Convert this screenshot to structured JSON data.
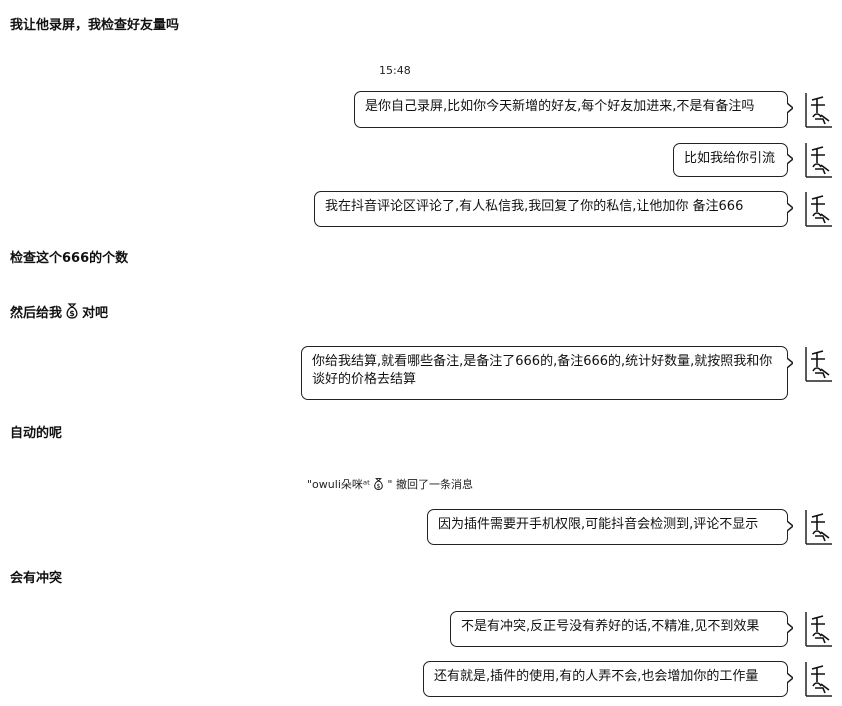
{
  "messages": {
    "m1": "我让他录屏，我检查好友量吗",
    "timestamp": "15:48",
    "m2": "是你自己录屏,比如你今天新增的好友,每个好友加进来,不是有备注吗",
    "m3": "比如我给你引流",
    "m4": "我在抖音评论区评论了,有人私信我,我回复了你的私信,让他加你  备注666",
    "m5": "检查这个666的个数",
    "m6_a": "然后给我",
    "m6_b": "对吧",
    "m7": "你给我结算,就看哪些备注,是备注了666的,备注666的,统计好数量,就按照我和你谈好的价格去结算",
    "m8": "自动的呢",
    "recall_name": "\"owuli朵咪ᵃᵗ",
    "recall_text": "\" 撤回了一条消息",
    "m9": "因为插件需要开手机权限,可能抖音会检测到,评论不显示",
    "m10": "会有冲突",
    "m11": "不是有冲突,反正号没有养好的话,不精准,见不到效果",
    "m12": "还有就是,插件的使用,有的人弄不会,也会增加你的工作量"
  },
  "icons": {
    "avatar": "avatar-icon",
    "emoji": "money-bag-icon"
  }
}
